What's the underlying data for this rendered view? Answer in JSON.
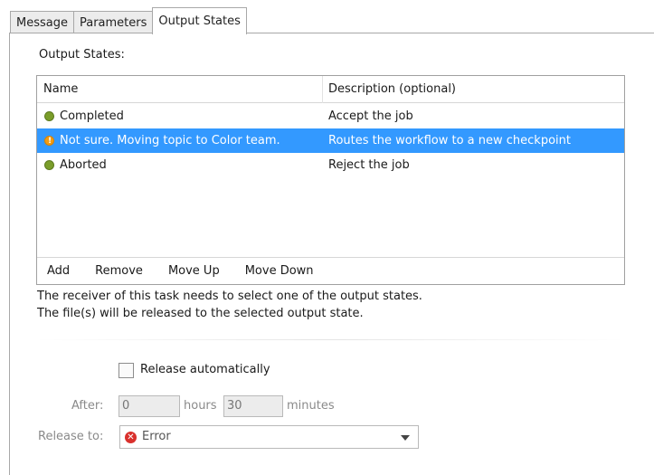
{
  "tabs": [
    {
      "label": "Message"
    },
    {
      "label": "Parameters"
    },
    {
      "label": "Output States",
      "active": true
    }
  ],
  "output_states": {
    "title": "Output States:",
    "columns": {
      "name": "Name",
      "description": "Description (optional)"
    },
    "rows": [
      {
        "name": "Completed",
        "description": "Accept the job",
        "icon": "green-dot-icon",
        "color": "#7a9d2a",
        "selected": false
      },
      {
        "name": "Not sure. Moving topic to Color team.",
        "description": "Routes the workflow to a new checkpoint",
        "icon": "warning-dot-icon",
        "color": "#f39c12",
        "selected": true
      },
      {
        "name": "Aborted",
        "description": "Reject the job",
        "icon": "green-dot-icon",
        "color": "#7a9d2a",
        "selected": false
      }
    ],
    "actions": [
      "Add",
      "Remove",
      "Move Up",
      "Move Down"
    ]
  },
  "info": {
    "line1": "The receiver of this task needs to select one of the output states.",
    "line2": "The file(s) will be released to the selected output state."
  },
  "release": {
    "auto_label": "Release automatically",
    "auto_checked": false,
    "after_label": "After:",
    "hours_value": "0",
    "hours_label": "hours",
    "minutes_value": "30",
    "minutes_label": "minutes",
    "release_to_label": "Release to:",
    "release_to_value": "Error",
    "release_to_icon": "error-icon"
  },
  "colors": {
    "selection": "#3399ff",
    "error": "#d9302c"
  }
}
